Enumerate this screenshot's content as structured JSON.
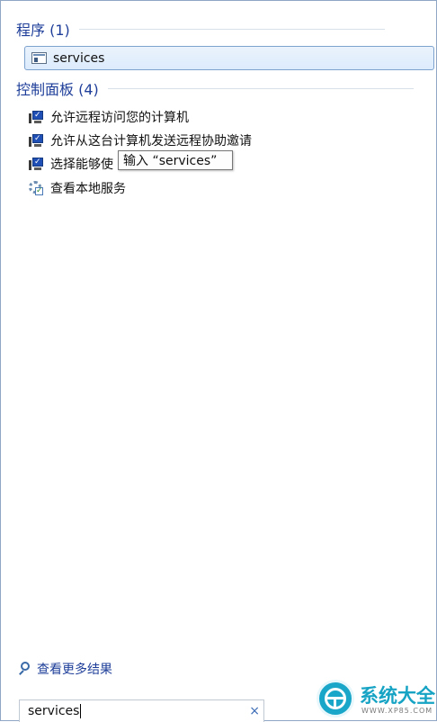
{
  "programs": {
    "title": "程序 (1)",
    "items": [
      {
        "label": "services",
        "icon": "services-icon"
      }
    ]
  },
  "control_panel": {
    "title": "控制面板 (4)",
    "items": [
      {
        "label": "允许远程访问您的计算机",
        "icon": "remote-monitor-icon"
      },
      {
        "label": "允许从这台计算机发送远程协助邀请",
        "icon": "remote-monitor-icon"
      },
      {
        "label": "选择能够使",
        "icon": "remote-monitor-icon"
      },
      {
        "label": "查看本地服务",
        "icon": "services-gear-icon"
      }
    ]
  },
  "tooltip": {
    "text": "输入 “services”"
  },
  "more_results": {
    "label": "查看更多结果"
  },
  "search": {
    "value": "services",
    "clear_icon": "×"
  },
  "watermark": {
    "title": "系统大全",
    "url": "WWW.XP85.COM"
  },
  "colors": {
    "section_title": "#1e3e99",
    "highlight_border": "#7da2ce",
    "highlight_fill": "#dcebfc"
  }
}
